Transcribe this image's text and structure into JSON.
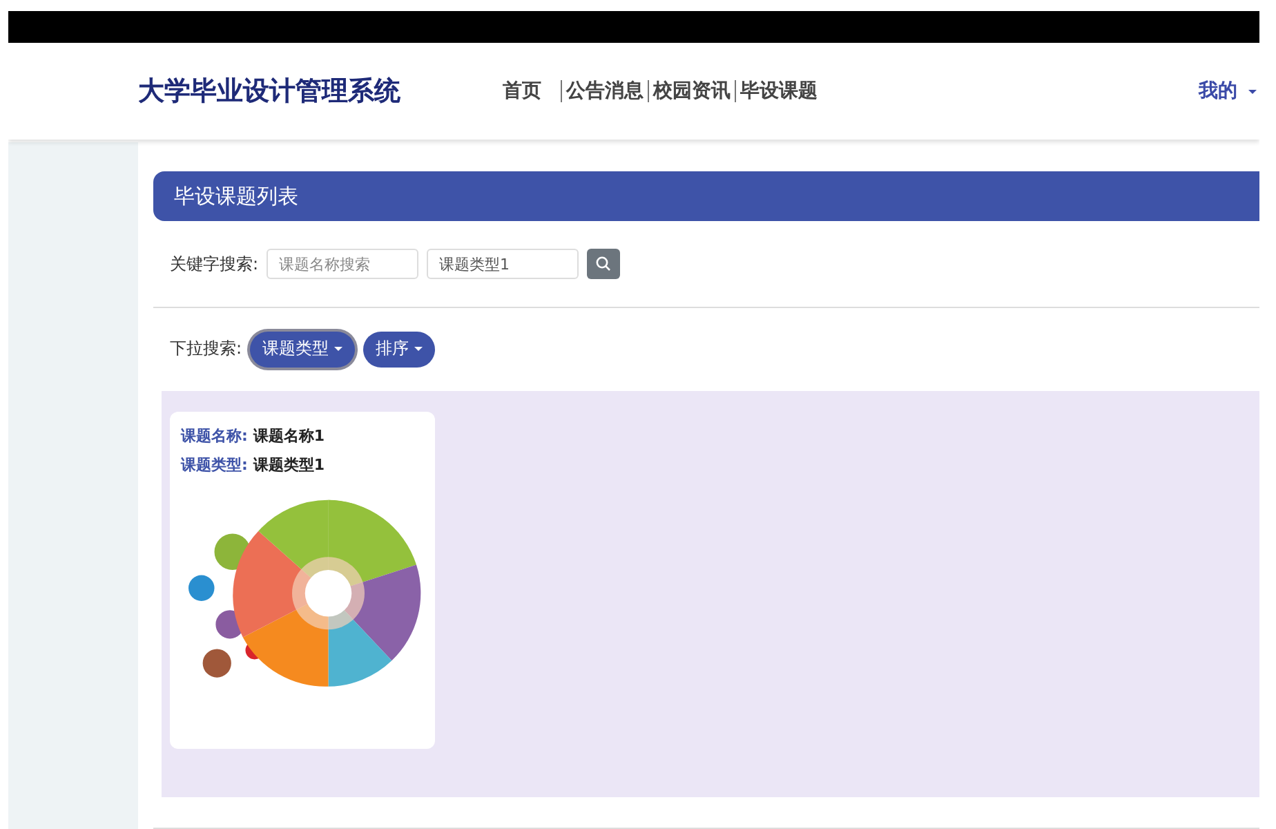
{
  "header": {
    "title": "大学毕业设计管理系统",
    "nav": [
      {
        "label": "首页"
      },
      {
        "label": "公告消息"
      },
      {
        "label": "校园资讯"
      },
      {
        "label": "毕设课题"
      }
    ],
    "user_menu": {
      "label": "我的"
    }
  },
  "panel": {
    "title": "毕设课题列表"
  },
  "keyword_search": {
    "label": "关键字搜索:",
    "fields": [
      {
        "placeholder": "课题名称搜索"
      },
      {
        "value": "课题类型1"
      }
    ]
  },
  "dropdown_search": {
    "label": "下拉搜索:",
    "buttons": [
      {
        "label": "课题类型",
        "focused": true
      },
      {
        "label": "排序",
        "focused": false
      }
    ]
  },
  "cards": [
    {
      "fields": [
        {
          "label": "课题名称:",
          "value": "课题名称1"
        },
        {
          "label": "课题类型:",
          "value": "课题类型1"
        }
      ]
    }
  ]
}
